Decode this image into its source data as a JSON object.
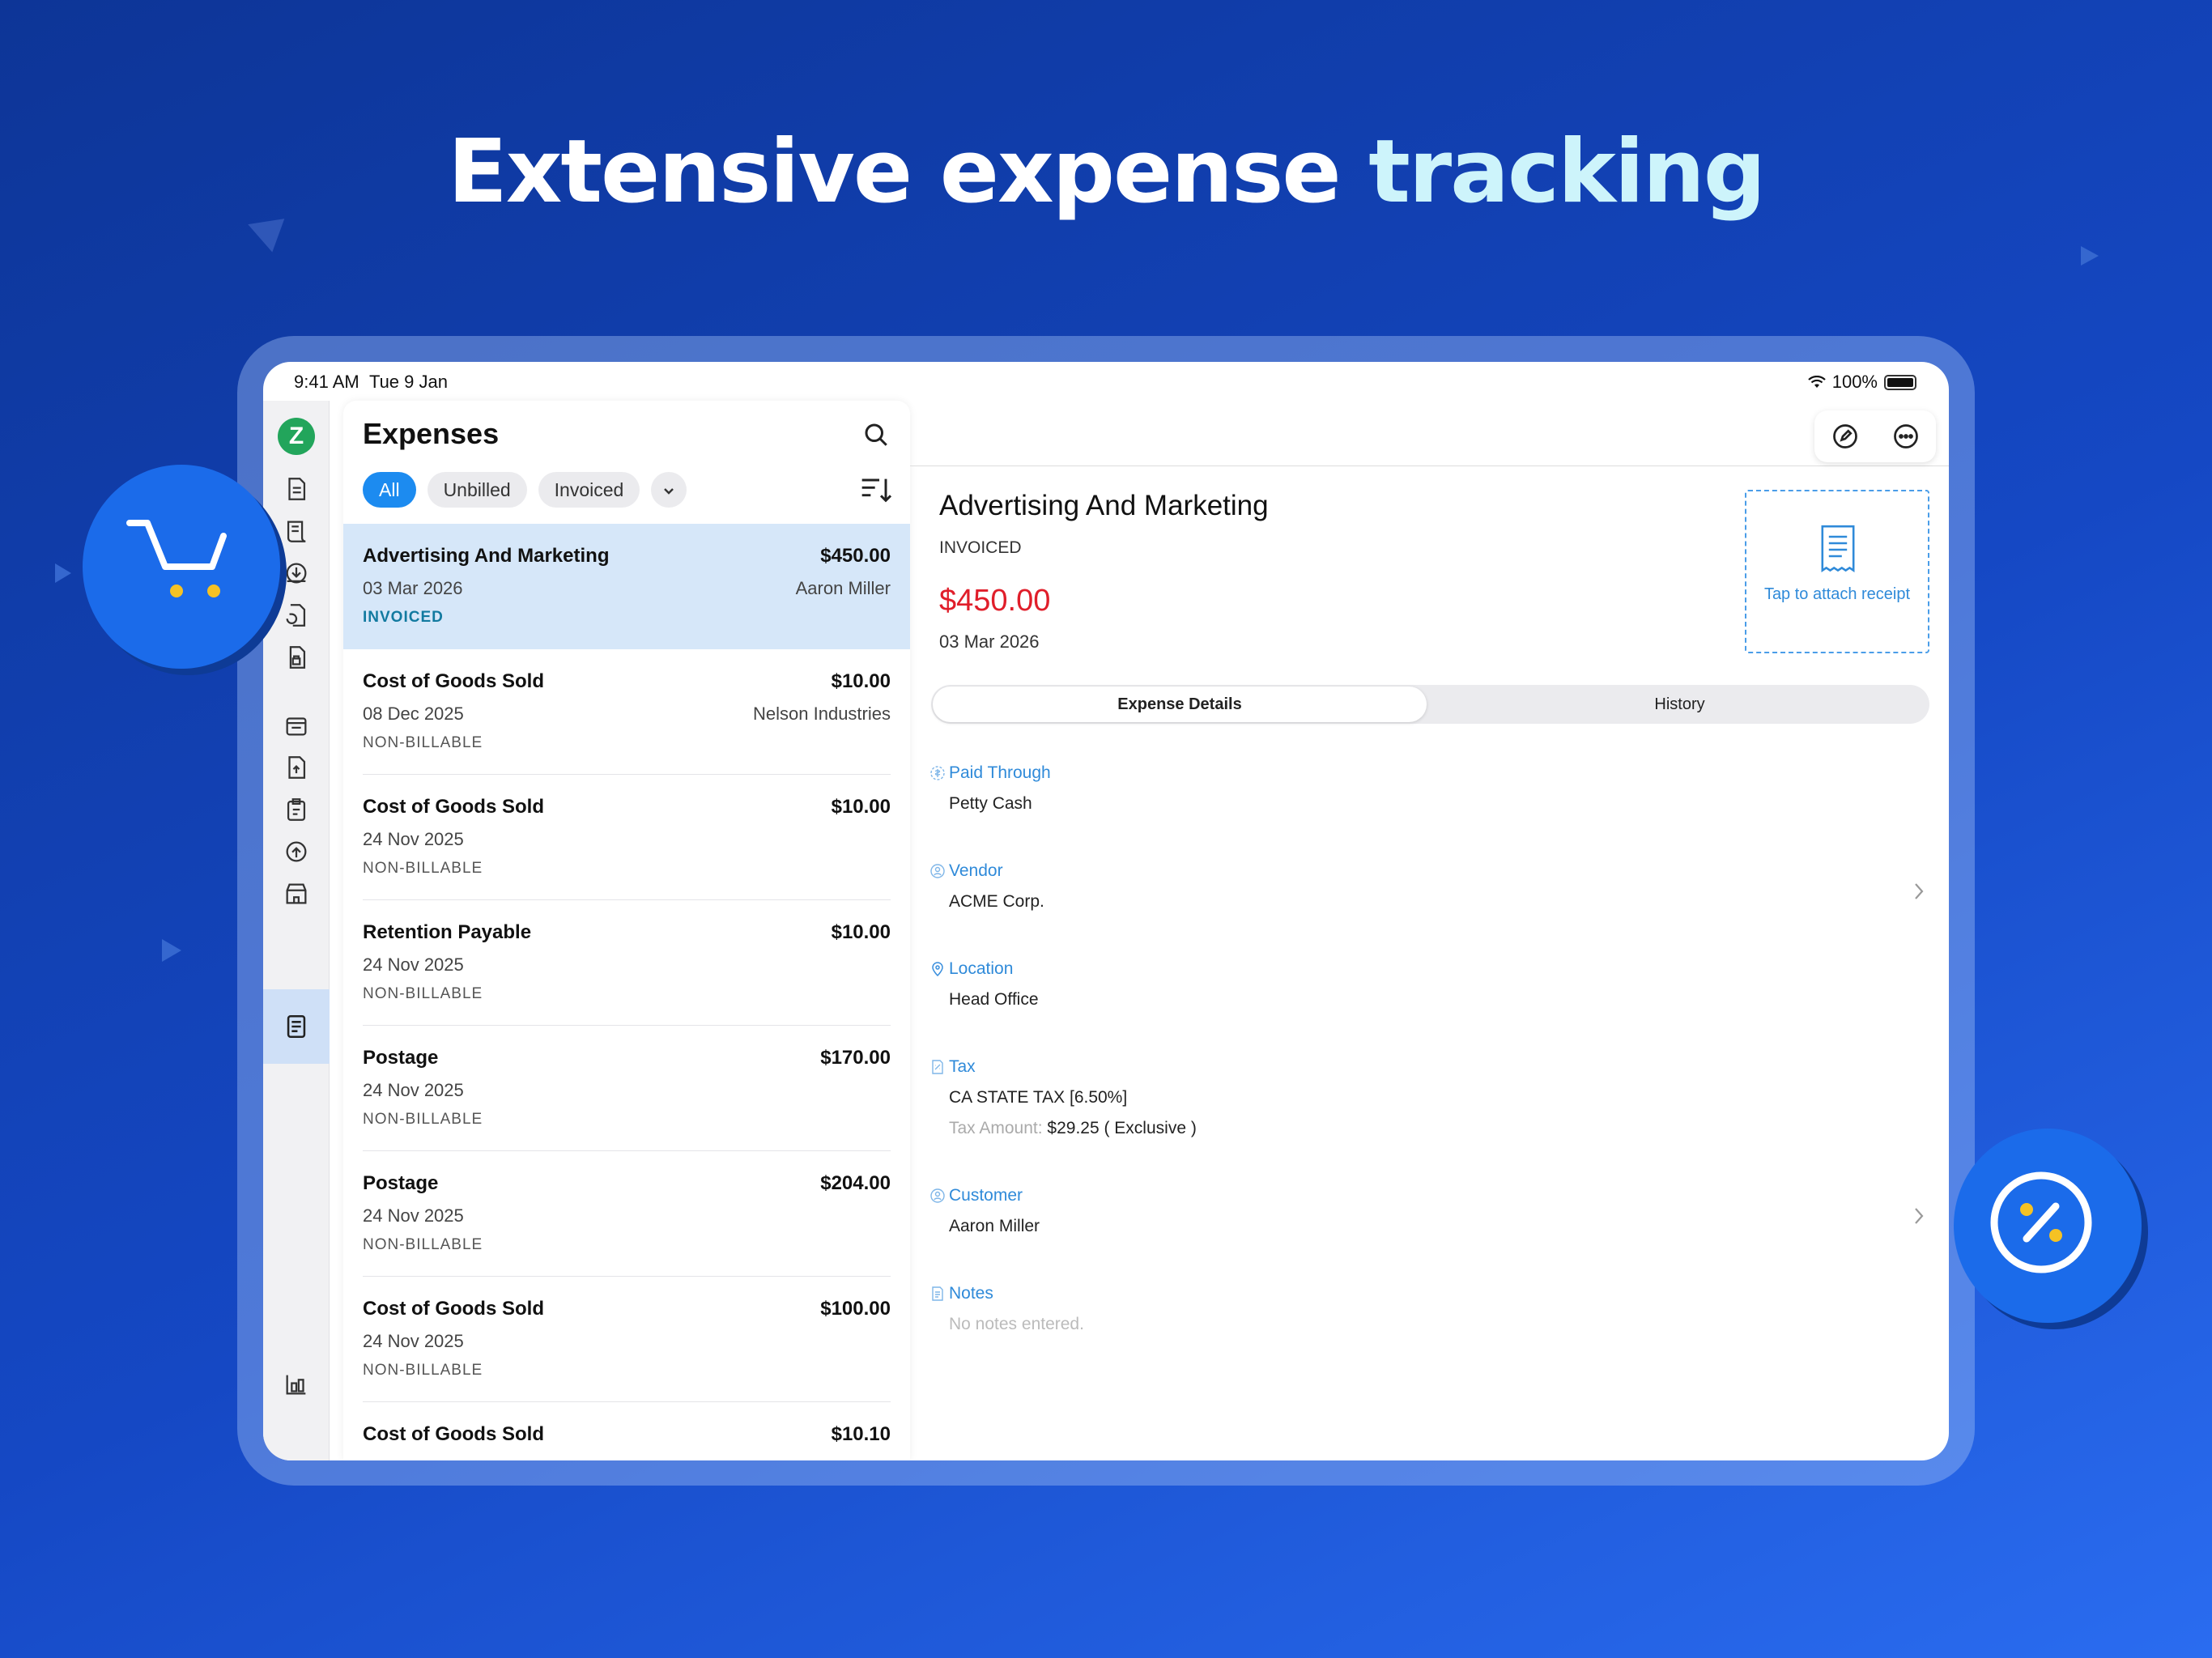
{
  "headline": {
    "part1": "Extensive expense ",
    "part2": "tracking"
  },
  "status_bar": {
    "time": "9:41 AM",
    "date": "Tue 9 Jan",
    "battery": "100%"
  },
  "sidebar": {
    "logo_letter": "Z",
    "icons": [
      "document-icon",
      "receipt-icon",
      "download-circle-icon",
      "document-refresh-icon",
      "document-lock-icon",
      "store-icon",
      "expense-receipt-icon",
      "document-upload-icon",
      "clipboard-icon",
      "upload-circle-icon",
      "store-front-icon",
      "reports-icon"
    ]
  },
  "list": {
    "title": "Expenses",
    "filters": [
      "All",
      "Unbilled",
      "Invoiced"
    ],
    "items": [
      {
        "name": "Advertising And Marketing",
        "amount": "$450.00",
        "date": "03 Mar 2026",
        "customer": "Aaron Miller",
        "status": "INVOICED"
      },
      {
        "name": "Cost of Goods Sold",
        "amount": "$10.00",
        "date": "08 Dec 2025",
        "customer": "Nelson Industries",
        "status": "NON-BILLABLE"
      },
      {
        "name": "Cost of Goods Sold",
        "amount": "$10.00",
        "date": "24 Nov 2025",
        "customer": "",
        "status": "NON-BILLABLE"
      },
      {
        "name": "Retention Payable",
        "amount": "$10.00",
        "date": "24 Nov 2025",
        "customer": "",
        "status": "NON-BILLABLE"
      },
      {
        "name": "Postage",
        "amount": "$170.00",
        "date": "24 Nov 2025",
        "customer": "",
        "status": "NON-BILLABLE"
      },
      {
        "name": "Postage",
        "amount": "$204.00",
        "date": "24 Nov 2025",
        "customer": "",
        "status": "NON-BILLABLE"
      },
      {
        "name": "Cost of Goods Sold",
        "amount": "$100.00",
        "date": "24 Nov 2025",
        "customer": "",
        "status": "NON-BILLABLE"
      },
      {
        "name": "Cost of Goods Sold",
        "amount": "$10.10",
        "date": "",
        "customer": "",
        "status": ""
      }
    ]
  },
  "detail": {
    "name": "Advertising And Marketing",
    "status": "INVOICED",
    "amount": "$450.00",
    "date": "03 Mar 2026",
    "receipt_text": "Tap to attach receipt",
    "tabs": [
      "Expense Details",
      "History"
    ],
    "fields": {
      "paid_through": {
        "label": "Paid Through",
        "value": "Petty Cash"
      },
      "vendor": {
        "label": "Vendor",
        "value": "ACME Corp."
      },
      "location": {
        "label": "Location",
        "value": "Head Office"
      },
      "tax": {
        "label": "Tax",
        "value": "CA STATE TAX [6.50%]",
        "amount_label": "Tax Amount:",
        "amount_value": "$29.25 ( Exclusive )"
      },
      "customer": {
        "label": "Customer",
        "value": "Aaron Miller"
      },
      "notes": {
        "label": "Notes",
        "value": "No notes entered."
      }
    }
  },
  "colors": {
    "accent": "#1c8bf0",
    "amount_red": "#e01e2a",
    "selected_row": "#d6e7f9",
    "background": "#1548c4"
  }
}
